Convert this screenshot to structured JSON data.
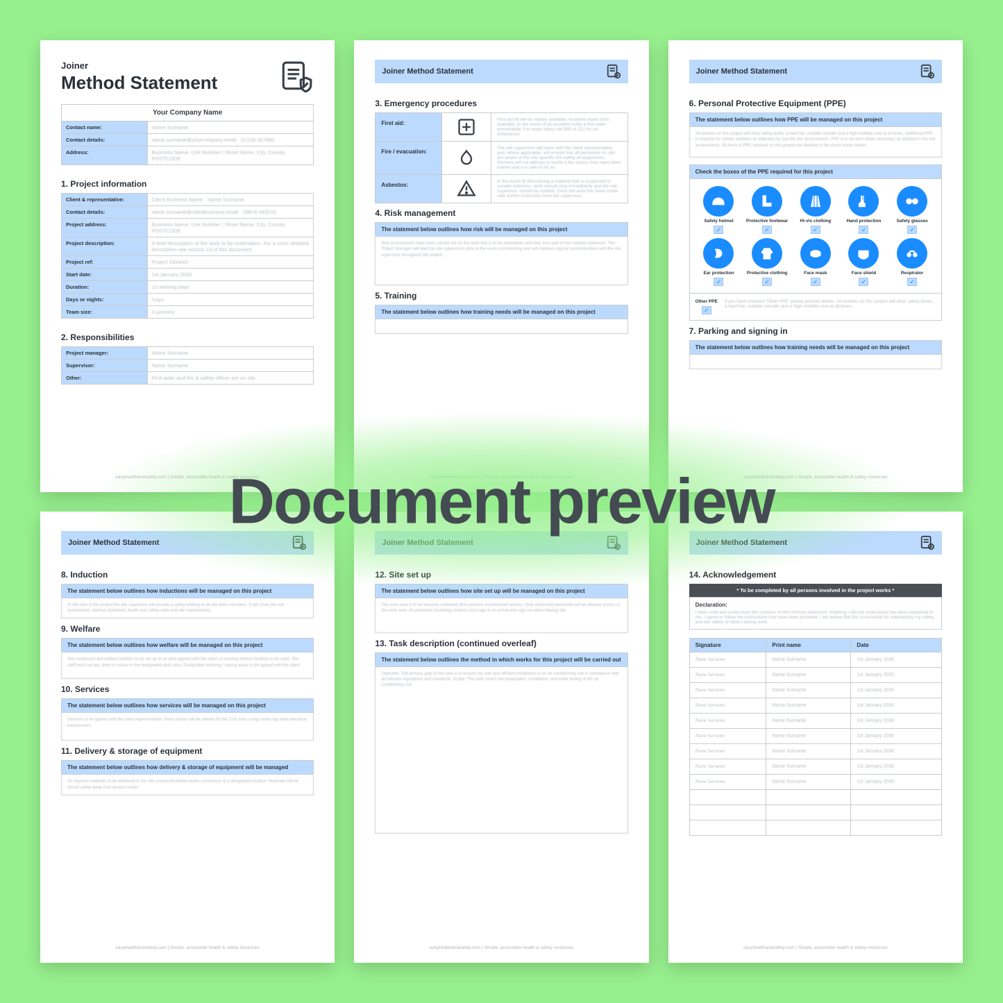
{
  "overlay": "Document preview",
  "footer": "easyhealthandsafety.com | Simple, accessible health & safety resources",
  "header_title": "Joiner Method Statement",
  "page1": {
    "small": "Joiner",
    "big": "Method Statement",
    "company_banner": "Your Company Name",
    "company_rows": [
      {
        "k": "Contact name:",
        "v": "Name Surname"
      },
      {
        "k": "Contact details:",
        "v": "name.surname@yourcompany.email · 01234 567890"
      },
      {
        "k": "Address:",
        "v": "Business Name, Unit Number / Street Name, City, County, POSTCODE"
      }
    ],
    "s1": "1. Project information",
    "proj_rows": [
      {
        "k": "Client & representative:",
        "v": "Client Business Name · Name Surname"
      },
      {
        "k": "Contact details:",
        "v": "name.surname@clientbusiness.email · 09876 543210"
      },
      {
        "k": "Project address:",
        "v": "Business Name, Unit Number / Street Name, City, County, POSTCODE"
      },
      {
        "k": "Project description:",
        "v": "A brief description of the work to be undertaken. For a more detailed description see section 13 of this document."
      },
      {
        "k": "Project ref:",
        "v": "Project 0434AD"
      },
      {
        "k": "Start date:",
        "v": "1st January 2030"
      },
      {
        "k": "Duration:",
        "v": "10 working days"
      },
      {
        "k": "Days or nights:",
        "v": "Days"
      },
      {
        "k": "Team size:",
        "v": "3 persons"
      }
    ],
    "s2": "2. Responsibilities",
    "resp_rows": [
      {
        "k": "Project manager:",
        "v": "Name Surname"
      },
      {
        "k": "Supervisor:",
        "v": "Name Surname"
      },
      {
        "k": "Other:",
        "v": "First-aider and fire & safety officer are on site"
      }
    ]
  },
  "page2": {
    "s3": "3. Emergency procedures",
    "rows": [
      {
        "label": "First aid:",
        "text": "First aid kit will be readily available. Accident report form available. In the event of an accident notify a first aider immediately. For major injury call 999 or 112 for an ambulance."
      },
      {
        "label": "Fire / evacuation:",
        "text": "The site supervisor will liaise with the client representative and, where applicable, will ensure that all personnel on site are aware of the site-specific fire safety arrangements. Workers will not attempt to tackle a fire unless they have been trained and it is safe to do so."
      },
      {
        "label": "Asbestos:",
        "text": "In the event of discovering a material that is suspected to contain asbestos, work should stop immediately and the site supervisor should be notified. Once the area has been made safe further instruction from the supervisor."
      }
    ],
    "s4": "4. Risk management",
    "s4_bar": "The statement below outlines how risk will be managed on this project",
    "s4_text": "Risk assessments have been carried out for the work that is to be undertaken and they form part of this method statement. The Project Manager will lead the site supervision prior to the works commencing and will maintain regular communication with the site supervisor throughout the project.",
    "s5": "5. Training",
    "s5_bar": "The statement below outlines how training needs will be managed on this project"
  },
  "page3": {
    "s6": "6. Personal Protective Equipment (PPE)",
    "s6_bar": "The statement below outlines how PPE will be managed on this project",
    "s6_text": "All workers on this project will wear safety boots, a hard hat, suitable overalls and a high-visibility vest at all times. Additional PPE is required for certain activities as indicated by specific risk assessments. PPE is to be worn when necessary as detailed in the risk assessments. All items of PPE required on this project are detailed in the check boxes below.",
    "check_bar": "Check the boxes of the PPE required for this project",
    "ppe_items": [
      "Safety helmet",
      "Protective footwear",
      "Hi-vis clothing",
      "Hand protection",
      "Safety glasses",
      "Ear protection",
      "Protective clothing",
      "Face mask",
      "Face shield",
      "Respirator"
    ],
    "other_label": "Other PPE",
    "other_text": "If you have checked 'Other PPE' please provide details. All workers on this project will wear safety boots, a hard hat, suitable overalls and a high-visibility vest at all times.",
    "s7": "7. Parking and signing in",
    "s7_bar": "The statement below outlines how training needs will be managed on this project"
  },
  "page4": {
    "s8": "8. Induction",
    "s8_bar": "The statement below outlines how inductions will be managed on this project",
    "s8_text": "At the start of the project the site supervisor will provide a safety briefing to all site team members. It will cover the risk assessment, method statement, health and safety rules and site requirements.",
    "s9": "9. Welfare",
    "s9_bar": "The statement below outlines how welfare will be managed on this project",
    "s9_text": "Site compound and welfare facilities to be set up or an area agreed with the client so existing welfare facilities to be used. Site staff must not eat, drink or smoke in the designated work area. Designated smoking / vaping areas to be agreed with the client.",
    "s10": "10. Services",
    "s10_bar": "The statement below outlines how services will be managed on this project",
    "s10_text": "Services to be agreed with the client representative. Mains power will be utilised for the 110v tools using centre tap earth electrical transformers.",
    "s11": "11. Delivery & storage of equipment",
    "s11_bar": "The statement below outlines how delivery & storage of equipment will be managed",
    "s11_text": "All required materials to be delivered to the site compound before works commence at a designated location. Materials will be stored safely away from access routes."
  },
  "page5": {
    "s12": "12. Site set up",
    "s12_bar": "The statement below outlines how site set up will be managed on this project",
    "s12_text": "The work area is to be securely cordoned off to prevent unauthorised access. Only authorised personnel will be allowed access to the work area. All personnel (including visitors) must sign in on arrival and sign out when leaving site.",
    "s13": "13. Task description (continued overleaf)",
    "s13_bar": "The statement below outlines the method in which works for this project will be carried out",
    "s13_text": "Objective: The primary goal of this task is to ensure the safe and efficient installation of an air conditioning unit in compliance with all relevant regulations and standards. Scope: This task covers the preparation, installation, and initial testing of the air conditioning unit."
  },
  "page6": {
    "s14": "14. Acknowledgement",
    "banner": "* To be completed by all persons involved in the project works *",
    "decl_label": "Declaration:",
    "decl_text": "I have read and understood the contents of this method statement. Anything I did not understand has been explained to me. I agree to follow the instructions that have been provided. I am aware that this is essential for maintaining my safety and the safety of others during work.",
    "cols": [
      "Signature",
      "Print name",
      "Date"
    ],
    "rows": [
      {
        "sig": "Name Surname",
        "name": "Name Surname",
        "date": "1st January 2030"
      },
      {
        "sig": "Name Surname",
        "name": "Name Surname",
        "date": "1st January 2030"
      },
      {
        "sig": "Name Surname",
        "name": "Name Surname",
        "date": "1st January 2030"
      },
      {
        "sig": "Name Surname",
        "name": "Name Surname",
        "date": "1st January 2030"
      },
      {
        "sig": "Name Surname",
        "name": "Name Surname",
        "date": "1st January 2030"
      },
      {
        "sig": "Name Surname",
        "name": "Name Surname",
        "date": "1st January 2030"
      },
      {
        "sig": "Name Surname",
        "name": "Name Surname",
        "date": "1st January 2030"
      },
      {
        "sig": "Name Surname",
        "name": "Name Surname",
        "date": "1st January 2030"
      },
      {
        "sig": "Name Surname",
        "name": "Name Surname",
        "date": "1st January 2030"
      }
    ]
  }
}
